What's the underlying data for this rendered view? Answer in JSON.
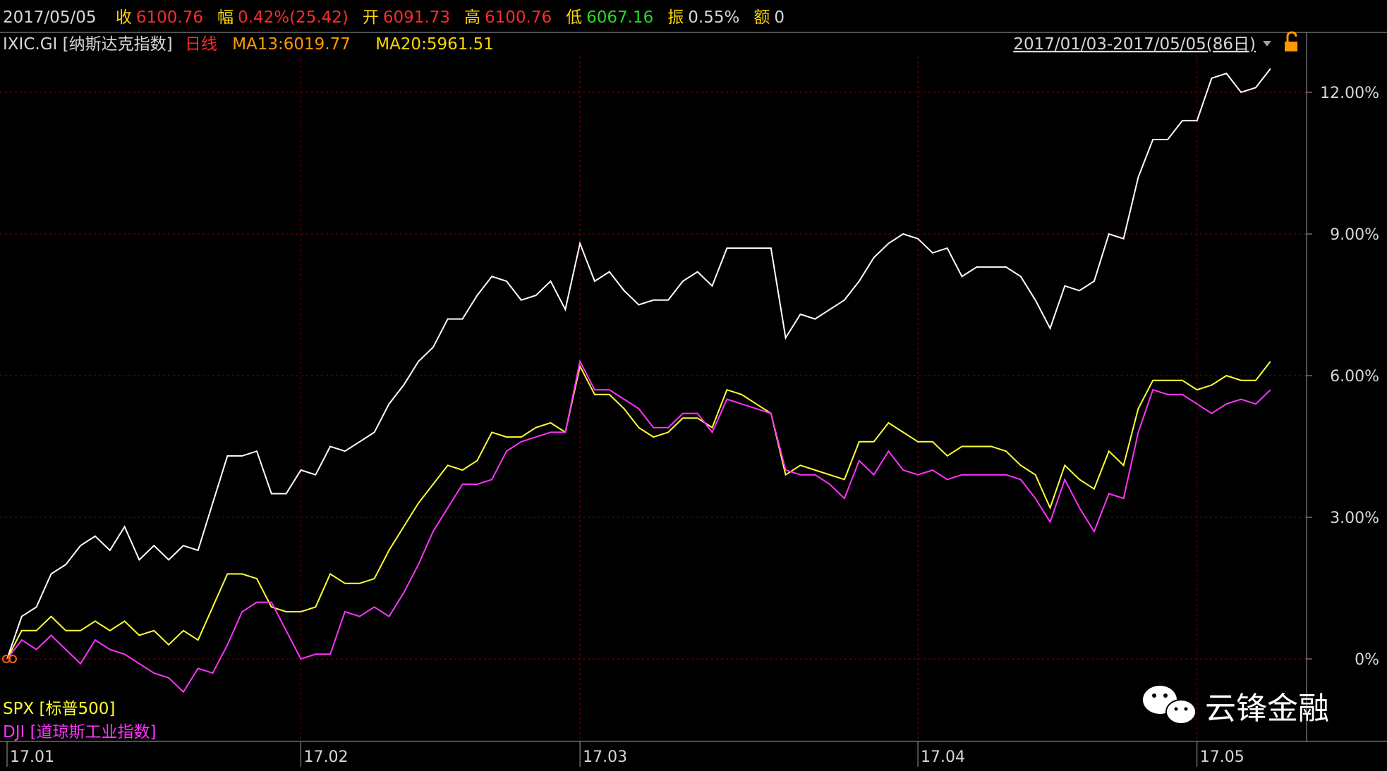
{
  "quote_bar": {
    "date": "2017/05/05",
    "items": [
      {
        "label": "收",
        "value": "6100.76",
        "color": "#ff2a2a"
      },
      {
        "label": "幅",
        "value": "0.42%(25.42)",
        "color": "#ff2a2a"
      },
      {
        "label": "开",
        "value": "6091.73",
        "color": "#ff2a2a"
      },
      {
        "label": "高",
        "value": "6100.76",
        "color": "#ff2a2a"
      },
      {
        "label": "低",
        "value": "6067.16",
        "color": "#22dd22"
      },
      {
        "label": "振",
        "value": "0.55%",
        "color": "#d8d8d8"
      },
      {
        "label": "额",
        "value": "0",
        "color": "#d8d8d8"
      }
    ],
    "label_color": "#ffd700"
  },
  "indicator_bar": {
    "code": "IXIC.GI [纳斯达克指数]",
    "period": "日线",
    "ma13": "MA13:6019.77",
    "ma20": "MA20:5961.51",
    "date_range": "2017/01/03-2017/05/05(86日)"
  },
  "watermark": {
    "icon": "wechat-icon",
    "text": "云锋金融"
  },
  "colors": {
    "background": "#000000",
    "grid": "#8b0000",
    "axis": "#a0a0a0",
    "ixic": "#ffffff",
    "spx": "#ffff33",
    "dji": "#ff33ff"
  },
  "chart_data": {
    "type": "line",
    "y_unit": "%",
    "ylim": [
      -1.2,
      13.0
    ],
    "yticks": [
      0,
      3,
      6,
      9,
      12
    ],
    "ytick_labels": [
      "0%",
      "3.00%",
      "6.00%",
      "9.00%",
      "12.00%"
    ],
    "x_count": 86,
    "xticks": [
      {
        "index": 0,
        "label": "17.01"
      },
      {
        "index": 20,
        "label": "17.02"
      },
      {
        "index": 39,
        "label": "17.03"
      },
      {
        "index": 62,
        "label": "17.04"
      },
      {
        "index": 81,
        "label": "17.05"
      }
    ],
    "grid": true,
    "legend_placement": "bottom-left",
    "series": [
      {
        "name": "IXIC.GI [纳斯达克指数]",
        "key": "ixic",
        "values": [
          0,
          0.9,
          1.1,
          1.8,
          2.0,
          2.4,
          2.6,
          2.3,
          2.8,
          2.1,
          2.4,
          2.1,
          2.4,
          2.3,
          3.3,
          4.3,
          4.3,
          4.4,
          3.5,
          3.5,
          4.0,
          3.9,
          4.5,
          4.4,
          4.6,
          4.8,
          5.4,
          5.8,
          6.3,
          6.6,
          7.2,
          7.2,
          7.7,
          8.1,
          8.0,
          7.6,
          7.7,
          8.0,
          7.4,
          8.8,
          8.0,
          8.2,
          7.8,
          7.5,
          7.6,
          7.6,
          8.0,
          8.2,
          7.9,
          8.7,
          8.7,
          8.7,
          8.7,
          6.8,
          7.3,
          7.2,
          7.4,
          7.6,
          8.0,
          8.5,
          8.8,
          9.0,
          8.9,
          8.6,
          8.7,
          8.1,
          8.3,
          8.3,
          8.3,
          8.1,
          7.6,
          7.0,
          7.9,
          7.8,
          8.0,
          9.0,
          8.9,
          10.2,
          11.0,
          11.0,
          11.4,
          11.4,
          12.3,
          12.4,
          12.0,
          12.1,
          12.5
        ]
      },
      {
        "name": "SPX [标普500]",
        "key": "spx",
        "values": [
          0,
          0.6,
          0.6,
          0.9,
          0.6,
          0.6,
          0.8,
          0.6,
          0.8,
          0.5,
          0.6,
          0.3,
          0.6,
          0.4,
          1.1,
          1.8,
          1.8,
          1.7,
          1.1,
          1.0,
          1.0,
          1.1,
          1.8,
          1.6,
          1.6,
          1.7,
          2.3,
          2.8,
          3.3,
          3.7,
          4.1,
          4.0,
          4.2,
          4.8,
          4.7,
          4.7,
          4.9,
          5.0,
          4.8,
          6.2,
          5.6,
          5.6,
          5.3,
          4.9,
          4.7,
          4.8,
          5.1,
          5.1,
          4.9,
          5.7,
          5.6,
          5.4,
          5.2,
          3.9,
          4.1,
          4.0,
          3.9,
          3.8,
          4.6,
          4.6,
          5.0,
          4.8,
          4.6,
          4.6,
          4.3,
          4.5,
          4.5,
          4.5,
          4.4,
          4.1,
          3.9,
          3.2,
          4.1,
          3.8,
          3.6,
          4.4,
          4.1,
          5.3,
          5.9,
          5.9,
          5.9,
          5.7,
          5.8,
          6.0,
          5.9,
          5.9,
          6.3
        ]
      },
      {
        "name": "DJI [道琼斯工业指数]",
        "key": "dji",
        "values": [
          0,
          0.4,
          0.2,
          0.5,
          0.2,
          -0.1,
          0.4,
          0.2,
          0.1,
          -0.1,
          -0.3,
          -0.4,
          -0.7,
          -0.2,
          -0.3,
          0.3,
          1.0,
          1.2,
          1.2,
          0.6,
          0.0,
          0.1,
          0.1,
          1.0,
          0.9,
          1.1,
          0.9,
          1.4,
          2.0,
          2.7,
          3.2,
          3.7,
          3.7,
          3.8,
          4.4,
          4.6,
          4.7,
          4.8,
          4.8,
          6.3,
          5.7,
          5.7,
          5.5,
          5.3,
          4.9,
          4.9,
          5.2,
          5.2,
          4.8,
          5.5,
          5.4,
          5.3,
          5.2,
          4.0,
          3.9,
          3.9,
          3.7,
          3.4,
          4.2,
          3.9,
          4.4,
          4.0,
          3.9,
          4.0,
          3.8,
          3.9,
          3.9,
          3.9,
          3.9,
          3.8,
          3.4,
          2.9,
          3.8,
          3.2,
          2.7,
          3.5,
          3.4,
          4.8,
          5.7,
          5.6,
          5.6,
          5.4,
          5.2,
          5.4,
          5.5,
          5.4,
          5.7
        ]
      }
    ]
  }
}
